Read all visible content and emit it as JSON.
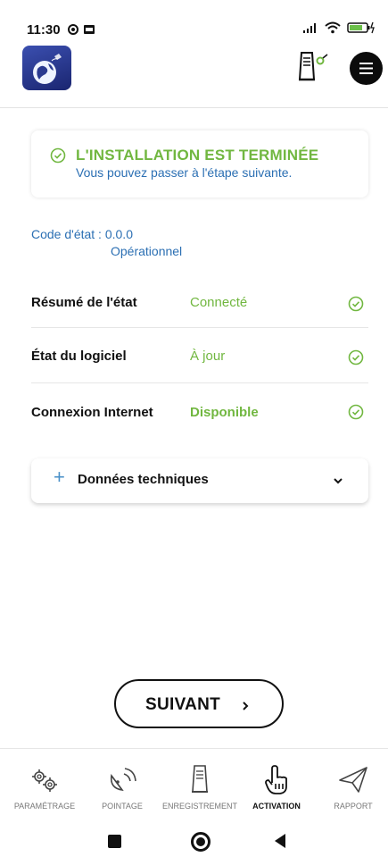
{
  "status_bar": {
    "time": "11:30",
    "icons_left": [
      "gear-status-icon",
      "notification-image-icon"
    ],
    "icons_right": [
      "signal-icon",
      "wifi-icon",
      "battery-charging-icon"
    ]
  },
  "header": {
    "logo": "globe-app-logo",
    "device_icon": "receiver-connected-icon",
    "menu_icon": "hamburger-menu-icon"
  },
  "success": {
    "title": "L'INSTALLATION EST TERMINÉE",
    "subtitle": "Vous pouvez passer à l'étape suivante.",
    "icon": "check-circle-icon"
  },
  "code": {
    "line1": "Code d'état : 0.0.0",
    "line2": "Opérationnel"
  },
  "rows": [
    {
      "label": "Résumé de l'état",
      "value": "Connecté",
      "bold": false,
      "icon": "check-circle-icon"
    },
    {
      "label": "État du logiciel",
      "value": "À jour",
      "bold": false,
      "icon": "check-circle-icon"
    },
    {
      "label": "Connexion Internet",
      "value": "Disponible",
      "bold": true,
      "icon": "check-circle-icon"
    }
  ],
  "tech": {
    "label": "Données techniques",
    "plus": "+",
    "chevron": "chevron-down-icon"
  },
  "next_button": {
    "label": "SUIVANT"
  },
  "nav": [
    {
      "label": "PARAMÉTRAGE",
      "icon": "gears-icon",
      "active": false
    },
    {
      "label": "POINTAGE",
      "icon": "satellite-dish-icon",
      "active": false
    },
    {
      "label": "ENREGISTREMENT",
      "icon": "receiver-device-icon",
      "active": false
    },
    {
      "label": "ACTIVATION",
      "icon": "pointing-hand-icon",
      "active": true
    },
    {
      "label": "RAPPORT",
      "icon": "paper-plane-icon",
      "active": false
    }
  ],
  "colors": {
    "green": "#71b740",
    "blue": "#2b6fb3",
    "dark": "#111111"
  }
}
